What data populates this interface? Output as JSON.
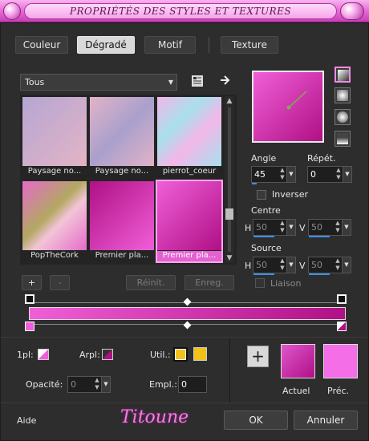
{
  "window": {
    "title": "PROPRIÉTÉS DES STYLES ET TEXTURES"
  },
  "tabs": [
    {
      "label": "Couleur",
      "active": false
    },
    {
      "label": "Dégradé",
      "active": true
    },
    {
      "label": "Motif",
      "active": false
    },
    {
      "label": "Texture",
      "active": false
    }
  ],
  "category": {
    "selected": "Tous"
  },
  "thumbnails": [
    {
      "caption": "Paysage no...",
      "colors": [
        "#b6a6d2",
        "#e3b4c6"
      ]
    },
    {
      "caption": "Paysage no...",
      "colors": [
        "#a9a0cc",
        "#e2b3c7"
      ]
    },
    {
      "caption": "pierrot_coeur",
      "colors": [
        "#a8e0ec",
        "#f2b7e8"
      ]
    },
    {
      "caption": "PopTheCork",
      "colors": [
        "#e56bc9",
        "#b2a862"
      ]
    },
    {
      "caption": "Premier pla...",
      "colors": [
        "#b01085",
        "#f05fd8"
      ]
    },
    {
      "caption": "Premier pla...",
      "colors": [
        "#f05fd8",
        "#b01085"
      ],
      "selected": true
    }
  ],
  "list_buttons": {
    "add": "+",
    "remove": "-",
    "reset": "Réinit.",
    "save": "Enreg."
  },
  "gradient": {
    "angle_label": "Angle",
    "angle": "45",
    "repeat_label": "Répét.",
    "repeat": "0",
    "invert_label": "Inverser",
    "center_label": "Centre",
    "center_h": "50",
    "center_v": "50",
    "source_label": "Source",
    "source_h": "50",
    "source_v": "50",
    "link_label": "Liaison",
    "h": "H",
    "v": "V",
    "start_color": "#f05fd8",
    "end_color": "#b01085"
  },
  "stop_panel": {
    "one_label": "1pl:",
    "rear_label": "Arpl:",
    "use_label": "Util.:",
    "opacity_label": "Opacité:",
    "opacity": "0",
    "position_label": "Empl.:",
    "position": "0",
    "current_label": "Actuel",
    "previous_label": "Préc.",
    "current_color": "#c5259f",
    "previous_color": "#f46ee8",
    "use_color": "#f2c21b"
  },
  "footer": {
    "help": "Aide",
    "ok": "OK",
    "cancel": "Annuler",
    "logo": "Titoune"
  }
}
